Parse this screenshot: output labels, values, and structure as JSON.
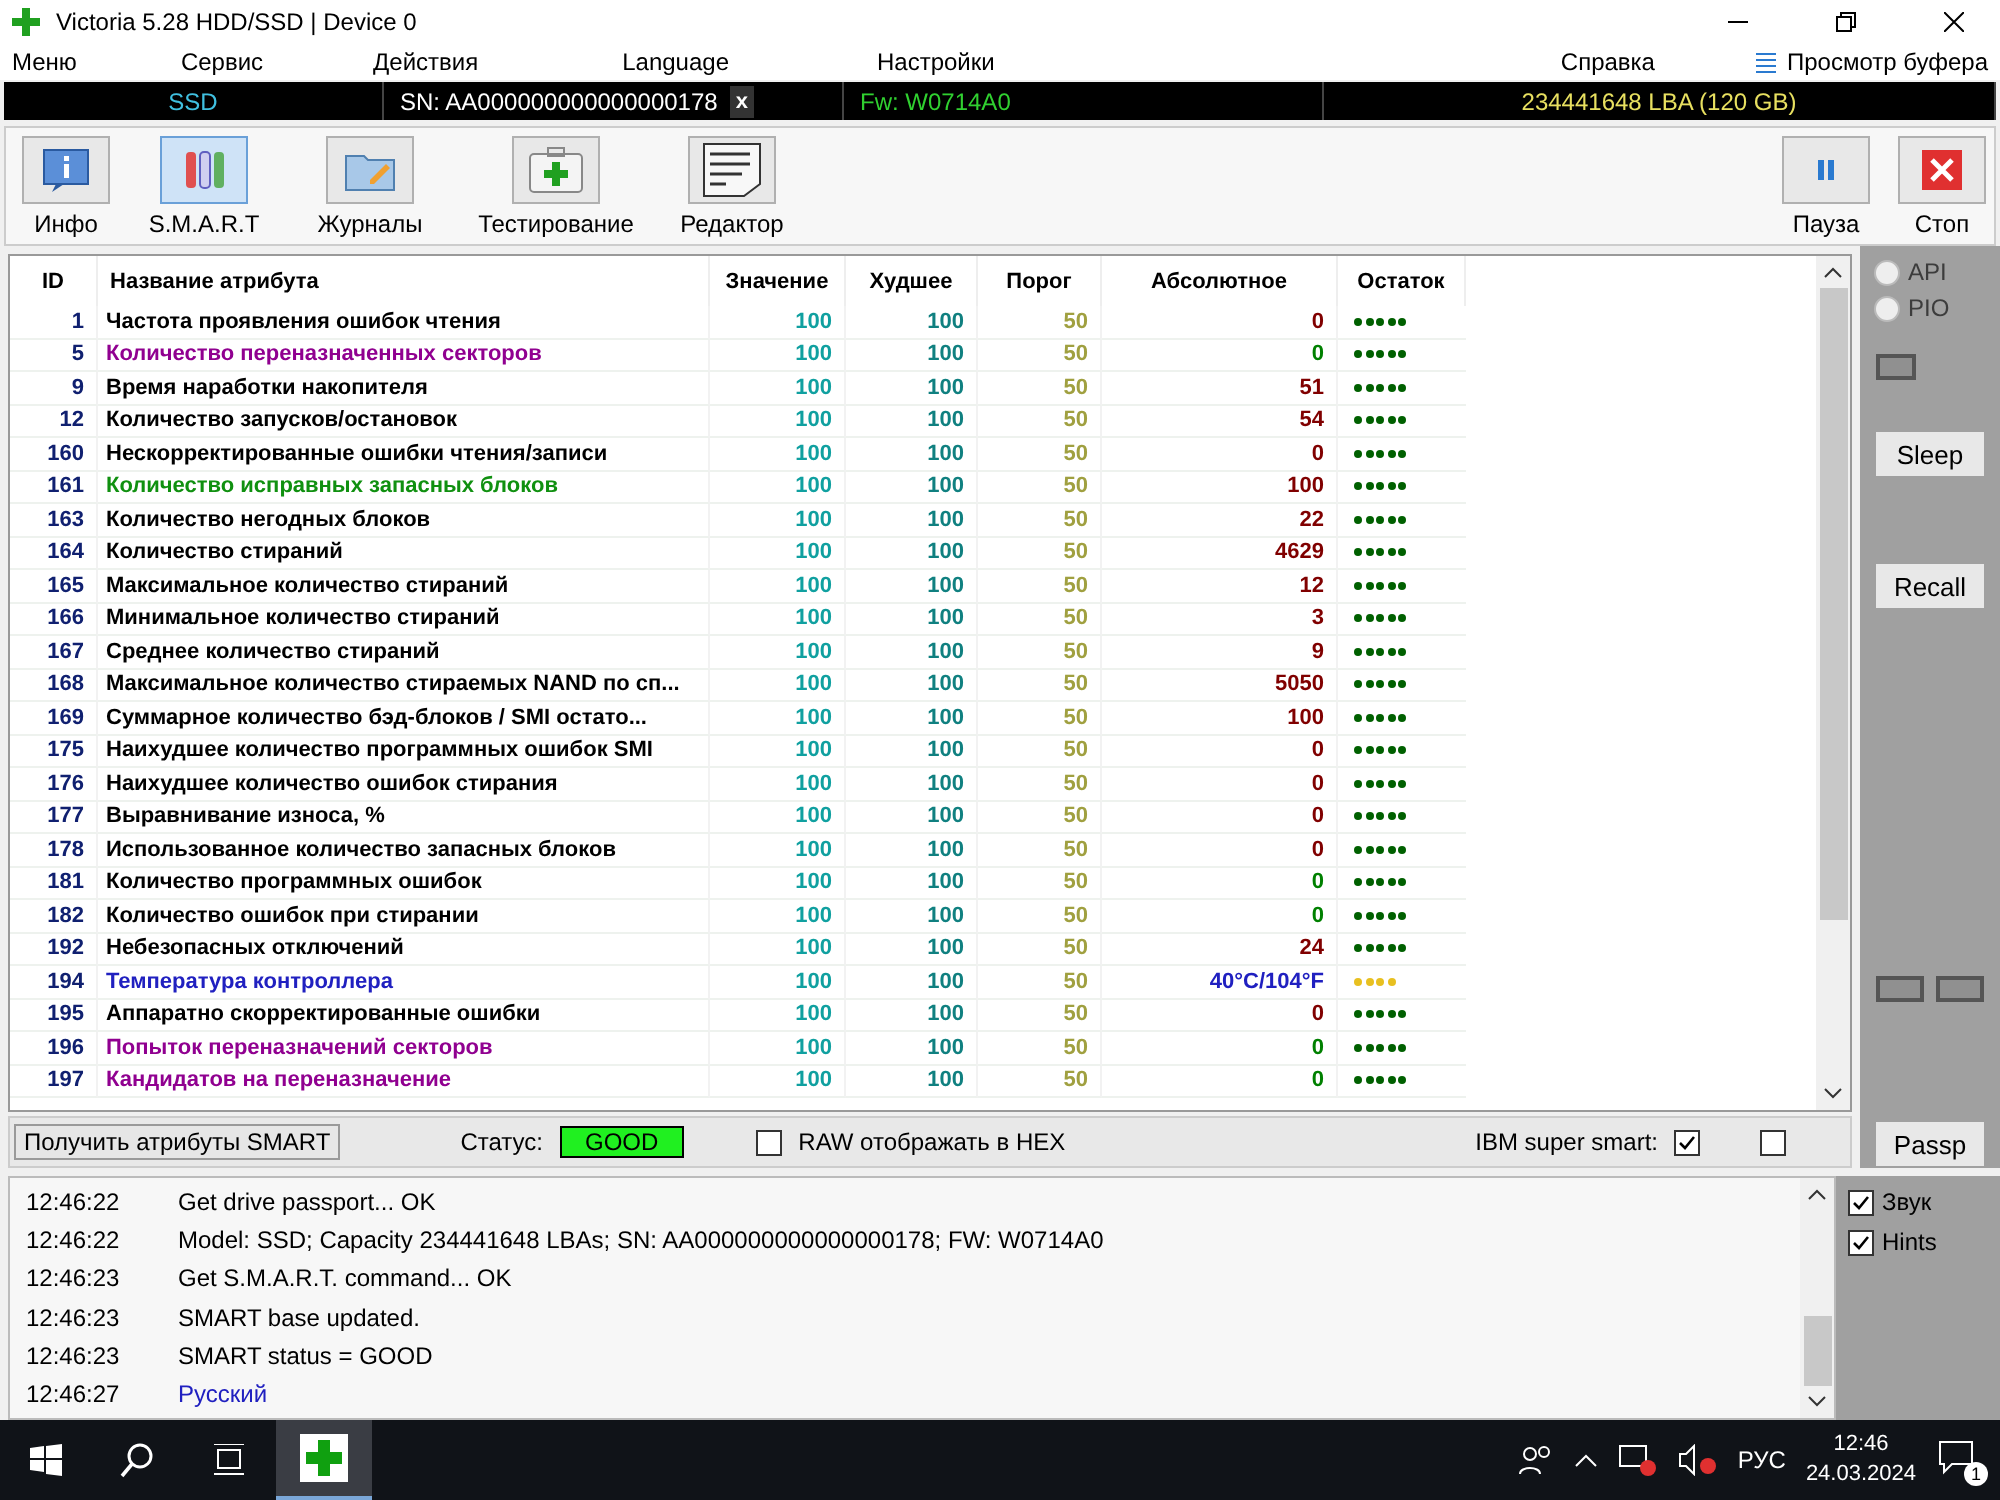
{
  "window": {
    "title": "Victoria 5.28 HDD/SSD | Device 0"
  },
  "menu": [
    "Меню",
    "Сервис",
    "Действия",
    "Language",
    "Настройки"
  ],
  "menu_right": [
    "Справка",
    "Просмотр буфера"
  ],
  "device_bar": {
    "type": "SSD",
    "serial": "SN: AA000000000000000178",
    "close": "x",
    "firmware": "Fw: W0714A0",
    "capacity": "234441648 LBA (120 GB)"
  },
  "toolbar": [
    {
      "label": "Инфо",
      "kind": "info",
      "selected": false
    },
    {
      "label": "S.M.A.R.T",
      "kind": "smart",
      "selected": true
    },
    {
      "label": "Журналы",
      "kind": "logs",
      "selected": false
    },
    {
      "label": "Тестирование",
      "kind": "test",
      "selected": false
    },
    {
      "label": "Редактор",
      "kind": "editor",
      "selected": false
    }
  ],
  "toolbar_right": [
    {
      "label": "Пауза",
      "kind": "pause"
    },
    {
      "label": "Стоп",
      "kind": "stop"
    }
  ],
  "table": {
    "columns": [
      "ID",
      "Название атрибута",
      "Значение",
      "Худшее",
      "Порог",
      "Абсолютное",
      "Остаток"
    ],
    "rows": [
      {
        "id": "1",
        "name": "Частота проявления ошибок чтения",
        "color": "#000000",
        "value": "100",
        "worst": "100",
        "threshold": "50",
        "raw": {
          "text": "0",
          "color": "#800000"
        },
        "remaining": {
          "stars": 5,
          "color": "#006000"
        }
      },
      {
        "id": "5",
        "name": "Количество переназначенных секторов",
        "color": "#900090",
        "value": "100",
        "worst": "100",
        "threshold": "50",
        "raw": {
          "text": "0",
          "color": "#008000"
        },
        "remaining": {
          "stars": 5,
          "color": "#006000"
        }
      },
      {
        "id": "9",
        "name": "Время наработки накопителя",
        "color": "#000000",
        "value": "100",
        "worst": "100",
        "threshold": "50",
        "raw": {
          "text": "51",
          "color": "#800000"
        },
        "remaining": {
          "stars": 5,
          "color": "#006000"
        }
      },
      {
        "id": "12",
        "name": "Количество запусков/остановок",
        "color": "#000000",
        "value": "100",
        "worst": "100",
        "threshold": "50",
        "raw": {
          "text": "54",
          "color": "#800000"
        },
        "remaining": {
          "stars": 5,
          "color": "#006000"
        }
      },
      {
        "id": "160",
        "name": "Нескорректированные ошибки чтения/записи",
        "color": "#000000",
        "value": "100",
        "worst": "100",
        "threshold": "50",
        "raw": {
          "text": "0",
          "color": "#800000"
        },
        "remaining": {
          "stars": 5,
          "color": "#006000"
        }
      },
      {
        "id": "161",
        "name": "Количество исправных запасных блоков",
        "color": "#109010",
        "value": "100",
        "worst": "100",
        "threshold": "50",
        "raw": {
          "text": "100",
          "color": "#800000"
        },
        "remaining": {
          "stars": 5,
          "color": "#006000"
        }
      },
      {
        "id": "163",
        "name": "Количество негодных блоков",
        "color": "#000000",
        "value": "100",
        "worst": "100",
        "threshold": "50",
        "raw": {
          "text": "22",
          "color": "#800000"
        },
        "remaining": {
          "stars": 5,
          "color": "#006000"
        }
      },
      {
        "id": "164",
        "name": "Количество стираний",
        "color": "#000000",
        "value": "100",
        "worst": "100",
        "threshold": "50",
        "raw": {
          "text": "4629",
          "color": "#800000"
        },
        "remaining": {
          "stars": 5,
          "color": "#006000"
        }
      },
      {
        "id": "165",
        "name": "Максимальное количество стираний",
        "color": "#000000",
        "value": "100",
        "worst": "100",
        "threshold": "50",
        "raw": {
          "text": "12",
          "color": "#800000"
        },
        "remaining": {
          "stars": 5,
          "color": "#006000"
        }
      },
      {
        "id": "166",
        "name": "Минимальное количество стираний",
        "color": "#000000",
        "value": "100",
        "worst": "100",
        "threshold": "50",
        "raw": {
          "text": "3",
          "color": "#800000"
        },
        "remaining": {
          "stars": 5,
          "color": "#006000"
        }
      },
      {
        "id": "167",
        "name": "Среднее количество стираний",
        "color": "#000000",
        "value": "100",
        "worst": "100",
        "threshold": "50",
        "raw": {
          "text": "9",
          "color": "#800000"
        },
        "remaining": {
          "stars": 5,
          "color": "#006000"
        }
      },
      {
        "id": "168",
        "name": "Максимальное количество стираемых NAND по сп...",
        "color": "#000000",
        "value": "100",
        "worst": "100",
        "threshold": "50",
        "raw": {
          "text": "5050",
          "color": "#800000"
        },
        "remaining": {
          "stars": 5,
          "color": "#006000"
        }
      },
      {
        "id": "169",
        "name": "Суммарное количество бэд-блоков / SMI остато...",
        "color": "#000000",
        "value": "100",
        "worst": "100",
        "threshold": "50",
        "raw": {
          "text": "100",
          "color": "#800000"
        },
        "remaining": {
          "stars": 5,
          "color": "#006000"
        }
      },
      {
        "id": "175",
        "name": "Наихудшее количество программных ошибок SMI",
        "color": "#000000",
        "value": "100",
        "worst": "100",
        "threshold": "50",
        "raw": {
          "text": "0",
          "color": "#800000"
        },
        "remaining": {
          "stars": 5,
          "color": "#006000"
        }
      },
      {
        "id": "176",
        "name": "Наихудшее количество ошибок стирания",
        "color": "#000000",
        "value": "100",
        "worst": "100",
        "threshold": "50",
        "raw": {
          "text": "0",
          "color": "#800000"
        },
        "remaining": {
          "stars": 5,
          "color": "#006000"
        }
      },
      {
        "id": "177",
        "name": "Выравнивание износа, %",
        "color": "#000000",
        "value": "100",
        "worst": "100",
        "threshold": "50",
        "raw": {
          "text": "0",
          "color": "#800000"
        },
        "remaining": {
          "stars": 5,
          "color": "#006000"
        }
      },
      {
        "id": "178",
        "name": "Использованное количество запасных блоков",
        "color": "#000000",
        "value": "100",
        "worst": "100",
        "threshold": "50",
        "raw": {
          "text": "0",
          "color": "#800000"
        },
        "remaining": {
          "stars": 5,
          "color": "#006000"
        }
      },
      {
        "id": "181",
        "name": "Количество программных ошибок",
        "color": "#000000",
        "value": "100",
        "worst": "100",
        "threshold": "50",
        "raw": {
          "text": "0",
          "color": "#008000"
        },
        "remaining": {
          "stars": 5,
          "color": "#006000"
        }
      },
      {
        "id": "182",
        "name": "Количество ошибок при стирании",
        "color": "#000000",
        "value": "100",
        "worst": "100",
        "threshold": "50",
        "raw": {
          "text": "0",
          "color": "#008000"
        },
        "remaining": {
          "stars": 5,
          "color": "#006000"
        }
      },
      {
        "id": "192",
        "name": "Небезопасных отключений",
        "color": "#000000",
        "value": "100",
        "worst": "100",
        "threshold": "50",
        "raw": {
          "text": "24",
          "color": "#800000"
        },
        "remaining": {
          "stars": 5,
          "color": "#006000"
        }
      },
      {
        "id": "194",
        "name": "Температура контроллера",
        "color": "#2020c0",
        "value": "100",
        "worst": "100",
        "threshold": "50",
        "raw": {
          "text": "40°C/104°F",
          "color": "#2020c0"
        },
        "remaining": {
          "stars": 4,
          "color": "#e8c020"
        }
      },
      {
        "id": "195",
        "name": "Аппаратно скорректированные ошибки",
        "color": "#000000",
        "value": "100",
        "worst": "100",
        "threshold": "50",
        "raw": {
          "text": "0",
          "color": "#800000"
        },
        "remaining": {
          "stars": 5,
          "color": "#006000"
        }
      },
      {
        "id": "196",
        "name": "Попыток переназначений секторов",
        "color": "#900090",
        "value": "100",
        "worst": "100",
        "threshold": "50",
        "raw": {
          "text": "0",
          "color": "#008000"
        },
        "remaining": {
          "stars": 5,
          "color": "#006000"
        }
      },
      {
        "id": "197",
        "name": "Кандидатов на переназначение",
        "color": "#900090",
        "value": "100",
        "worst": "100",
        "threshold": "50",
        "raw": {
          "text": "0",
          "color": "#008000"
        },
        "remaining": {
          "stars": 5,
          "color": "#006000"
        }
      }
    ]
  },
  "side_panel": {
    "radios": [
      {
        "label": "API",
        "selected": false,
        "disabled": true
      },
      {
        "label": "PIO",
        "selected": false,
        "disabled": true
      }
    ],
    "buttons": [
      {
        "label": "Sleep"
      },
      {
        "label": "Recall"
      },
      {
        "label": "Passp"
      }
    ]
  },
  "smart_bar": {
    "button": "Получить атрибуты SMART",
    "status_label": "Статус:",
    "status": "GOOD",
    "hex": {
      "label": "RAW отображать в HEX",
      "checked": false
    },
    "ibm": {
      "label": "IBM super smart:",
      "checked": true
    },
    "extra_checked": false
  },
  "log": [
    {
      "time": "12:46:22",
      "message": "Get drive passport... OK",
      "color": "#000000"
    },
    {
      "time": "12:46:22",
      "message": "Model: SSD; Capacity 234441648 LBAs; SN: AA000000000000000178; FW: W0714A0",
      "color": "#000000"
    },
    {
      "time": "12:46:23",
      "message": "Get S.M.A.R.T. command... OK",
      "color": "#000000"
    },
    {
      "time": "12:46:23",
      "message": "SMART base updated.",
      "color": "#000000"
    },
    {
      "time": "12:46:23",
      "message": "SMART status = GOOD",
      "color": "#000000"
    },
    {
      "time": "12:46:27",
      "message": "Русский",
      "color": "#2020c0"
    }
  ],
  "log_options": [
    {
      "label": "Звук",
      "checked": true
    },
    {
      "label": "Hints",
      "checked": true
    }
  ],
  "taskbar": {
    "language": "РУС",
    "time": "12:46",
    "date": "24.03.2024",
    "notifications": "1"
  }
}
